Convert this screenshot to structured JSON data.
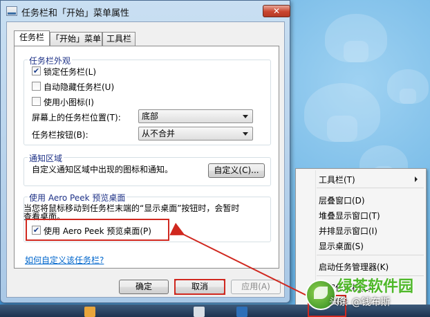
{
  "window": {
    "title": "任务栏和「开始」菜单属性",
    "close": "✕"
  },
  "tabs": [
    "任务栏",
    "「开始」菜单",
    "工具栏"
  ],
  "appearance": {
    "group_label": "任务栏外观",
    "lock_taskbar": {
      "label": "锁定任务栏(L)",
      "checked": true
    },
    "autohide": {
      "label": "自动隐藏任务栏(U)",
      "checked": false
    },
    "small_icons": {
      "label": "使用小图标(I)",
      "checked": false
    },
    "position_label": "屏幕上的任务栏位置(T):",
    "position_value": "底部",
    "buttons_label": "任务栏按钮(B):",
    "buttons_value": "从不合并"
  },
  "notification": {
    "group_label": "通知区域",
    "description": "自定义通知区域中出现的图标和通知。",
    "customize_button": "自定义(C)..."
  },
  "aero_peek": {
    "group_label": "使用 Aero Peek 预览桌面",
    "description_line1": "当您将鼠标移动到任务栏末端的“显示桌面”按钮时，会暂时",
    "description_line2": "查看桌面。",
    "checkbox": {
      "label": "使用 Aero Peek 预览桌面(P)",
      "checked": true
    }
  },
  "help_link": "如何自定义该任务栏?",
  "buttons": {
    "ok": "确定",
    "cancel": "取消",
    "apply": "应用(A)"
  },
  "context_menu": {
    "items": [
      {
        "label": "工具栏(T)",
        "submenu": true
      },
      {
        "label": "层叠窗口(D)"
      },
      {
        "label": "堆叠显示窗口(T)"
      },
      {
        "label": "并排显示窗口(I)"
      },
      {
        "label": "显示桌面(S)"
      },
      {
        "label": "启动任务管理器(K)"
      },
      {
        "label": "锁定任务栏(L)"
      },
      {
        "label": "属性(R)"
      }
    ]
  },
  "watermark": {
    "title": "绿茶软件园",
    "subtitle": "头条 @钱布斯"
  },
  "colors": {
    "annotation_red": "#d0281f",
    "link_blue": "#0066cc",
    "group_label_blue": "#1e3287"
  }
}
